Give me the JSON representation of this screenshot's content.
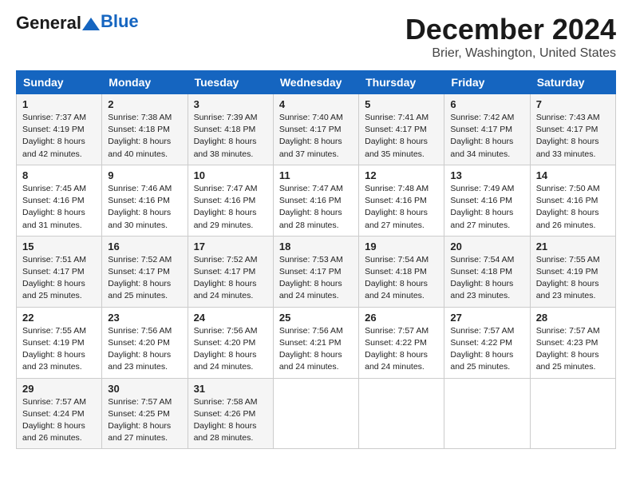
{
  "header": {
    "logo_general": "General",
    "logo_blue": "Blue",
    "month_title": "December 2024",
    "subtitle": "Brier, Washington, United States"
  },
  "weekdays": [
    "Sunday",
    "Monday",
    "Tuesday",
    "Wednesday",
    "Thursday",
    "Friday",
    "Saturday"
  ],
  "weeks": [
    [
      {
        "day": "1",
        "sunrise": "Sunrise: 7:37 AM",
        "sunset": "Sunset: 4:19 PM",
        "daylight": "Daylight: 8 hours and 42 minutes."
      },
      {
        "day": "2",
        "sunrise": "Sunrise: 7:38 AM",
        "sunset": "Sunset: 4:18 PM",
        "daylight": "Daylight: 8 hours and 40 minutes."
      },
      {
        "day": "3",
        "sunrise": "Sunrise: 7:39 AM",
        "sunset": "Sunset: 4:18 PM",
        "daylight": "Daylight: 8 hours and 38 minutes."
      },
      {
        "day": "4",
        "sunrise": "Sunrise: 7:40 AM",
        "sunset": "Sunset: 4:17 PM",
        "daylight": "Daylight: 8 hours and 37 minutes."
      },
      {
        "day": "5",
        "sunrise": "Sunrise: 7:41 AM",
        "sunset": "Sunset: 4:17 PM",
        "daylight": "Daylight: 8 hours and 35 minutes."
      },
      {
        "day": "6",
        "sunrise": "Sunrise: 7:42 AM",
        "sunset": "Sunset: 4:17 PM",
        "daylight": "Daylight: 8 hours and 34 minutes."
      },
      {
        "day": "7",
        "sunrise": "Sunrise: 7:43 AM",
        "sunset": "Sunset: 4:17 PM",
        "daylight": "Daylight: 8 hours and 33 minutes."
      }
    ],
    [
      {
        "day": "8",
        "sunrise": "Sunrise: 7:45 AM",
        "sunset": "Sunset: 4:16 PM",
        "daylight": "Daylight: 8 hours and 31 minutes."
      },
      {
        "day": "9",
        "sunrise": "Sunrise: 7:46 AM",
        "sunset": "Sunset: 4:16 PM",
        "daylight": "Daylight: 8 hours and 30 minutes."
      },
      {
        "day": "10",
        "sunrise": "Sunrise: 7:47 AM",
        "sunset": "Sunset: 4:16 PM",
        "daylight": "Daylight: 8 hours and 29 minutes."
      },
      {
        "day": "11",
        "sunrise": "Sunrise: 7:47 AM",
        "sunset": "Sunset: 4:16 PM",
        "daylight": "Daylight: 8 hours and 28 minutes."
      },
      {
        "day": "12",
        "sunrise": "Sunrise: 7:48 AM",
        "sunset": "Sunset: 4:16 PM",
        "daylight": "Daylight: 8 hours and 27 minutes."
      },
      {
        "day": "13",
        "sunrise": "Sunrise: 7:49 AM",
        "sunset": "Sunset: 4:16 PM",
        "daylight": "Daylight: 8 hours and 27 minutes."
      },
      {
        "day": "14",
        "sunrise": "Sunrise: 7:50 AM",
        "sunset": "Sunset: 4:16 PM",
        "daylight": "Daylight: 8 hours and 26 minutes."
      }
    ],
    [
      {
        "day": "15",
        "sunrise": "Sunrise: 7:51 AM",
        "sunset": "Sunset: 4:17 PM",
        "daylight": "Daylight: 8 hours and 25 minutes."
      },
      {
        "day": "16",
        "sunrise": "Sunrise: 7:52 AM",
        "sunset": "Sunset: 4:17 PM",
        "daylight": "Daylight: 8 hours and 25 minutes."
      },
      {
        "day": "17",
        "sunrise": "Sunrise: 7:52 AM",
        "sunset": "Sunset: 4:17 PM",
        "daylight": "Daylight: 8 hours and 24 minutes."
      },
      {
        "day": "18",
        "sunrise": "Sunrise: 7:53 AM",
        "sunset": "Sunset: 4:17 PM",
        "daylight": "Daylight: 8 hours and 24 minutes."
      },
      {
        "day": "19",
        "sunrise": "Sunrise: 7:54 AM",
        "sunset": "Sunset: 4:18 PM",
        "daylight": "Daylight: 8 hours and 24 minutes."
      },
      {
        "day": "20",
        "sunrise": "Sunrise: 7:54 AM",
        "sunset": "Sunset: 4:18 PM",
        "daylight": "Daylight: 8 hours and 23 minutes."
      },
      {
        "day": "21",
        "sunrise": "Sunrise: 7:55 AM",
        "sunset": "Sunset: 4:19 PM",
        "daylight": "Daylight: 8 hours and 23 minutes."
      }
    ],
    [
      {
        "day": "22",
        "sunrise": "Sunrise: 7:55 AM",
        "sunset": "Sunset: 4:19 PM",
        "daylight": "Daylight: 8 hours and 23 minutes."
      },
      {
        "day": "23",
        "sunrise": "Sunrise: 7:56 AM",
        "sunset": "Sunset: 4:20 PM",
        "daylight": "Daylight: 8 hours and 23 minutes."
      },
      {
        "day": "24",
        "sunrise": "Sunrise: 7:56 AM",
        "sunset": "Sunset: 4:20 PM",
        "daylight": "Daylight: 8 hours and 24 minutes."
      },
      {
        "day": "25",
        "sunrise": "Sunrise: 7:56 AM",
        "sunset": "Sunset: 4:21 PM",
        "daylight": "Daylight: 8 hours and 24 minutes."
      },
      {
        "day": "26",
        "sunrise": "Sunrise: 7:57 AM",
        "sunset": "Sunset: 4:22 PM",
        "daylight": "Daylight: 8 hours and 24 minutes."
      },
      {
        "day": "27",
        "sunrise": "Sunrise: 7:57 AM",
        "sunset": "Sunset: 4:22 PM",
        "daylight": "Daylight: 8 hours and 25 minutes."
      },
      {
        "day": "28",
        "sunrise": "Sunrise: 7:57 AM",
        "sunset": "Sunset: 4:23 PM",
        "daylight": "Daylight: 8 hours and 25 minutes."
      }
    ],
    [
      {
        "day": "29",
        "sunrise": "Sunrise: 7:57 AM",
        "sunset": "Sunset: 4:24 PM",
        "daylight": "Daylight: 8 hours and 26 minutes."
      },
      {
        "day": "30",
        "sunrise": "Sunrise: 7:57 AM",
        "sunset": "Sunset: 4:25 PM",
        "daylight": "Daylight: 8 hours and 27 minutes."
      },
      {
        "day": "31",
        "sunrise": "Sunrise: 7:58 AM",
        "sunset": "Sunset: 4:26 PM",
        "daylight": "Daylight: 8 hours and 28 minutes."
      },
      null,
      null,
      null,
      null
    ]
  ]
}
